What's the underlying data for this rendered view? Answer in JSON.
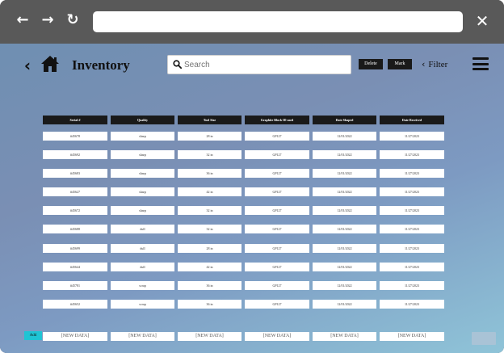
{
  "browser": {
    "back_icon": "←",
    "forward_icon": "→",
    "reload_icon": "↻",
    "close_icon": "✕",
    "url": ""
  },
  "header": {
    "back_icon": "‹",
    "title": "Inventory",
    "search_placeholder": "Search",
    "delete_label": "Delete",
    "mark_label": "Mark",
    "filter_label": "Filter",
    "filter_chevron": "‹"
  },
  "table": {
    "columns": [
      "Serial #",
      "Quality",
      "Tool Size",
      "Graphite Block ID used",
      "Date Shaped",
      "Date Received"
    ],
    "rows": [
      [
        "#45678",
        "sharp",
        "28 in",
        "GP127",
        "12/01/2022",
        "11/27/2023"
      ],
      [
        "#45692",
        "sharp",
        "32 in",
        "GP127",
        "12/01/2022",
        "11/27/2023"
      ],
      [
        "#45683",
        "sharp",
        "36 in",
        "GP127",
        "12/01/2022",
        "11/27/2023"
      ],
      [
        "#45627",
        "sharp",
        "42 in",
        "GP127",
        "12/01/2022",
        "11/27/2023"
      ],
      [
        "#45672",
        "sharp",
        "32 in",
        "GP127",
        "12/01/2022",
        "11/27/2023"
      ],
      [
        "#45688",
        "dull",
        "32 in",
        "GP127",
        "12/01/2022",
        "11/27/2023"
      ],
      [
        "#45699",
        "dull",
        "28 in",
        "GP127",
        "12/01/2022",
        "11/27/2023"
      ],
      [
        "#45644",
        "dull",
        "42 in",
        "GP127",
        "12/01/2022",
        "11/27/2023"
      ],
      [
        "#45781",
        "scrap",
        "36 in",
        "GP127",
        "12/01/2022",
        "11/27/2023"
      ],
      [
        "#45652",
        "scrap",
        "36 in",
        "GP127",
        "12/01/2022",
        "11/27/2023"
      ]
    ],
    "add_label": "Add",
    "new_data_label": "[NEW DATA]"
  },
  "colors": {
    "header_bg": "#1a1a1a",
    "add_accent": "#1fc4d4",
    "chrome": "#595959"
  }
}
